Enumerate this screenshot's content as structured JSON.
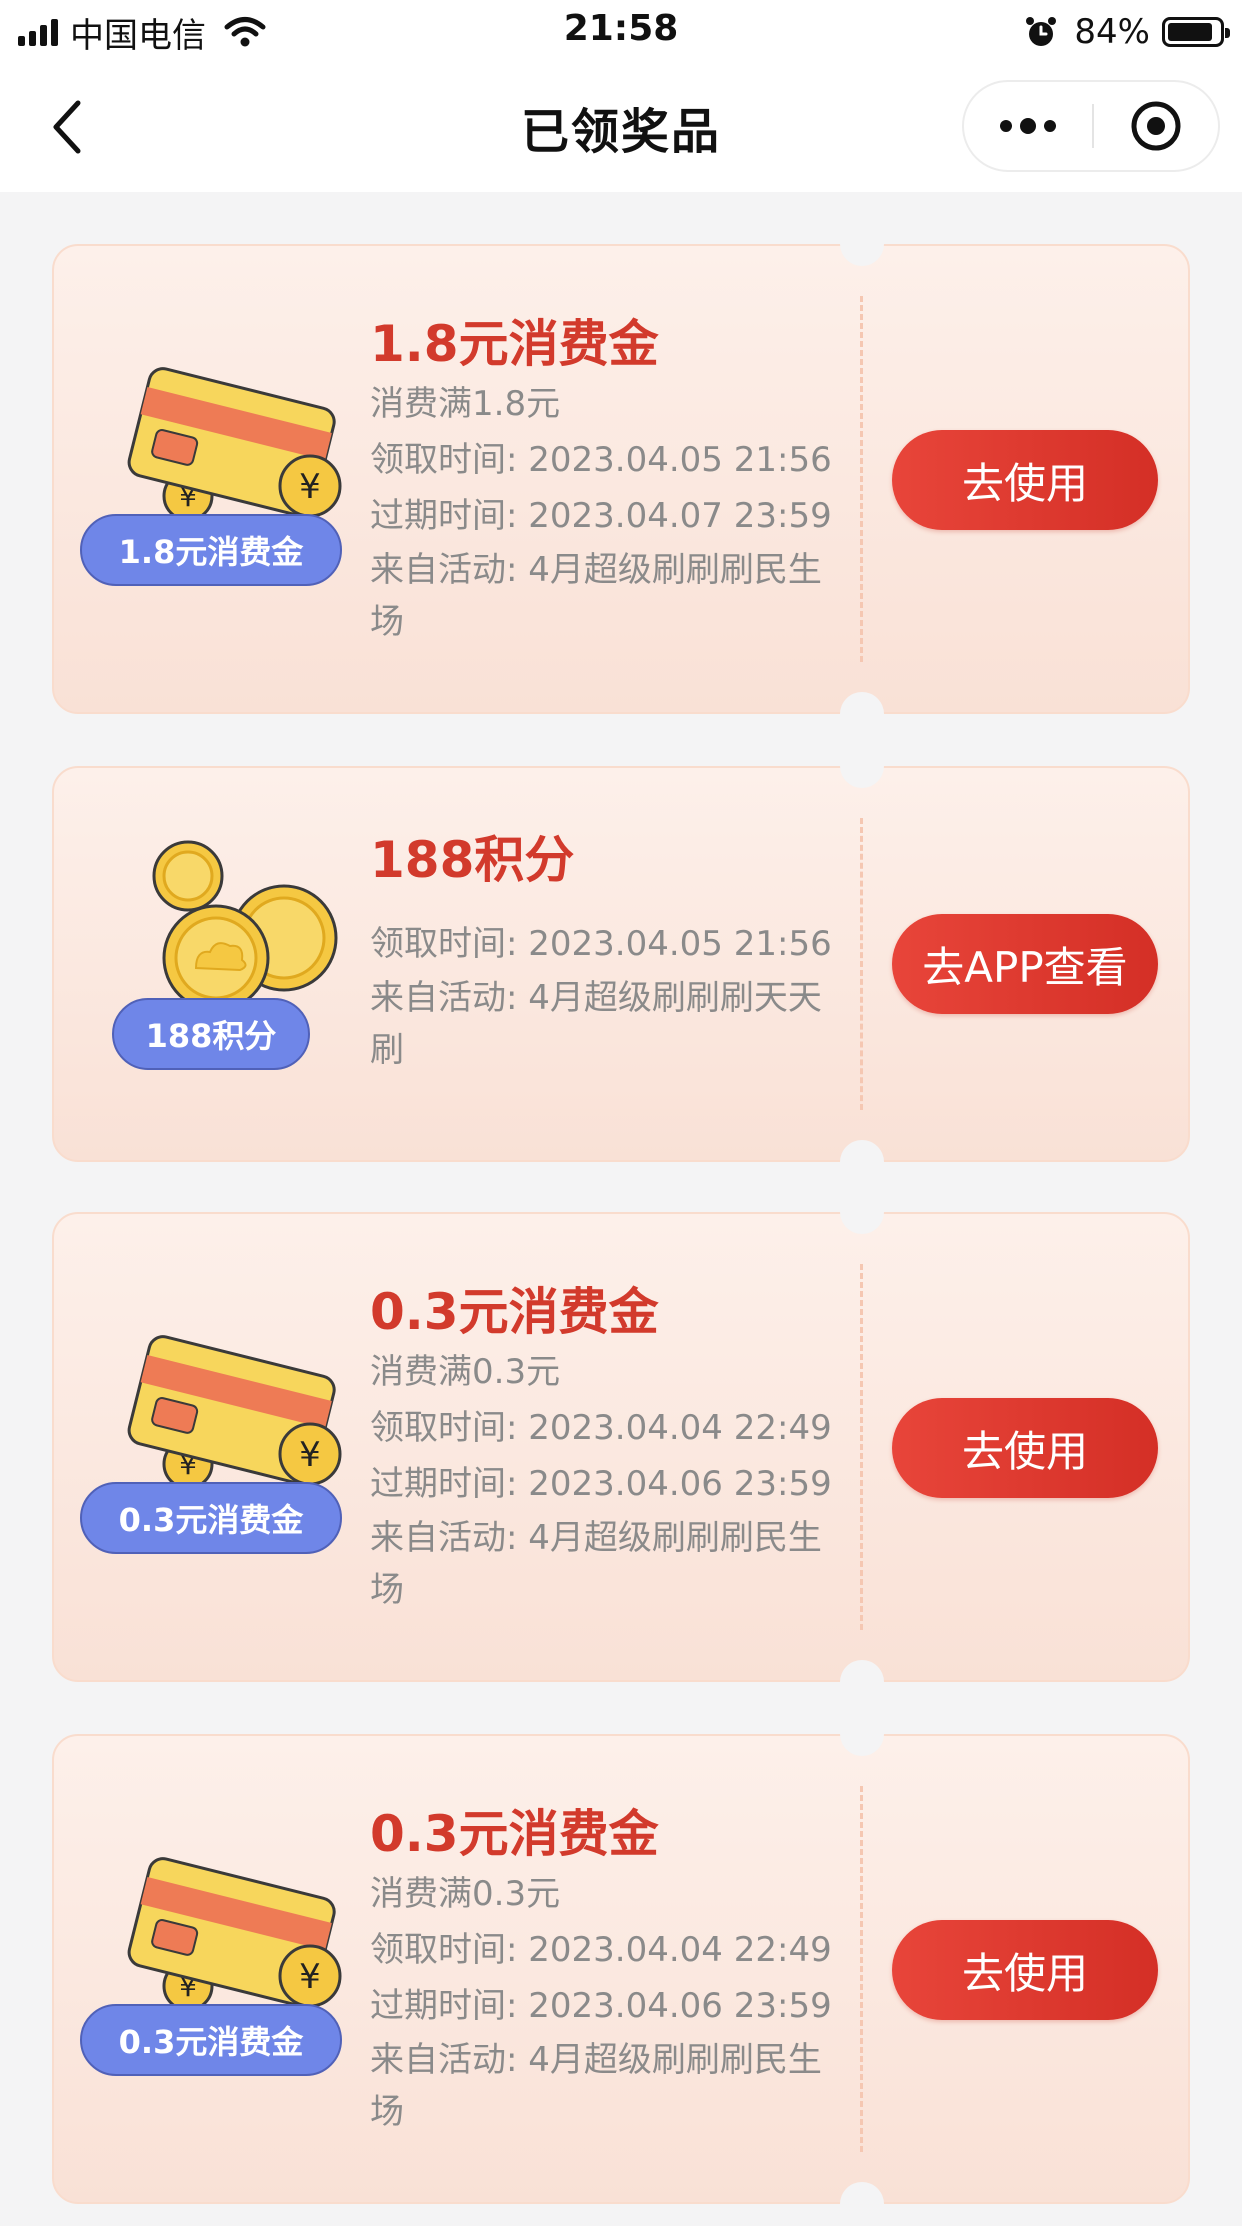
{
  "status_bar": {
    "carrier": "中国电信",
    "time": "21:58",
    "battery": "84%",
    "battery_level": 0.84
  },
  "nav": {
    "title": "已领奖品",
    "back_icon": "chevron-left-icon",
    "more_icon": "more-dots-icon",
    "close_icon": "target-icon"
  },
  "prizes": [
    {
      "title": "1.8元消费金",
      "tag": "1.8元消费金",
      "image": "card-coins-icon",
      "condition": "消费满1.8元",
      "claim_time": "领取时间: 2023.04.05 21:56",
      "expire_time": "过期时间: 2023.04.07 23:59",
      "source": "来自活动: 4月超级刷刷刷民生场",
      "button": "去使用"
    },
    {
      "title": "188积分",
      "tag": "188积分",
      "image": "gold-coins-icon",
      "claim_time": "领取时间: 2023.04.05 21:56",
      "source": "来自活动: 4月超级刷刷刷天天刷",
      "button": "去APP查看"
    },
    {
      "title": "0.3元消费金",
      "tag": "0.3元消费金",
      "image": "card-coins-icon",
      "condition": "消费满0.3元",
      "claim_time": "领取时间: 2023.04.04 22:49",
      "expire_time": "过期时间: 2023.04.06 23:59",
      "source": "来自活动: 4月超级刷刷刷民生场",
      "button": "去使用"
    },
    {
      "title": "0.3元消费金",
      "tag": "0.3元消费金",
      "image": "card-coins-icon",
      "condition": "消费满0.3元",
      "claim_time": "领取时间: 2023.04.04 22:49",
      "expire_time": "过期时间: 2023.04.06 23:59",
      "source": "来自活动: 4月超级刷刷刷民生场",
      "button": "去使用"
    }
  ],
  "colors": {
    "accent": "#d42f26",
    "title_red": "#d23a2c",
    "tag_blue": "#6f86e8",
    "card_bg": "#fdf0ea"
  }
}
